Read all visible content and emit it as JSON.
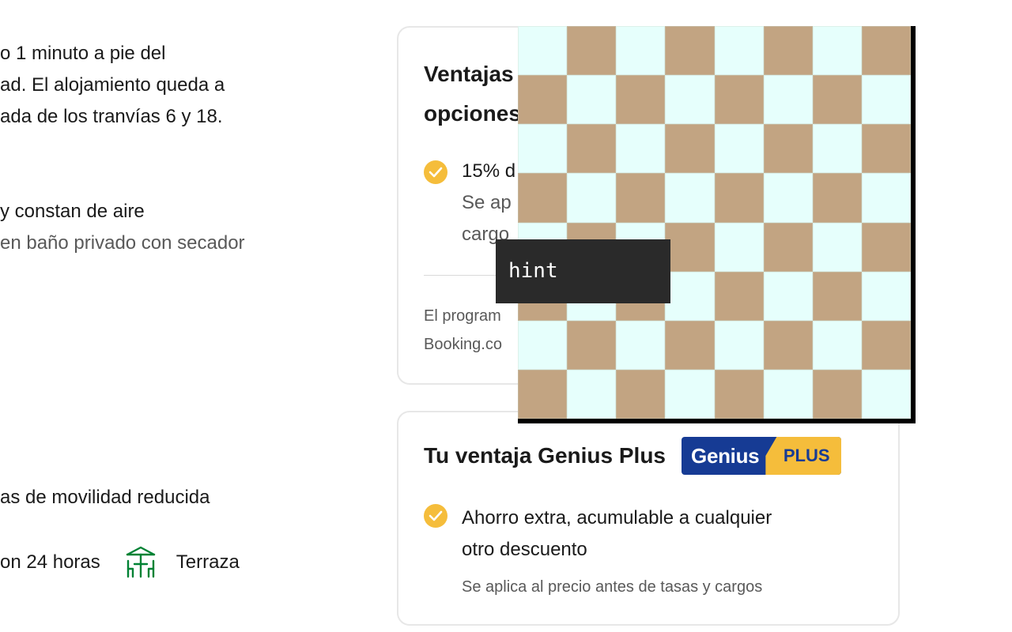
{
  "left": {
    "description_lines": [
      "o 1 minuto a pie del",
      "ad. El alojamiento queda a",
      "ada de los tranvías 6 y 18."
    ],
    "rooms_line1": "y constan de aire",
    "rooms_line2": "en baño privado con secador",
    "mobility": "as de movilidad reducida",
    "facility_1": "on 24 horas",
    "facility_2": "Terraza",
    "facility_2_icon": "terrace-icon"
  },
  "card_top": {
    "title_line1": "Ventajas",
    "title_line2": "opciones",
    "benefit_main": "15% d",
    "benefit_sub_1": "Se ap",
    "benefit_sub_2": "cargo",
    "footer_line1": "El program",
    "footer_line2": "Booking.co"
  },
  "card_bottom": {
    "title": "Tu ventaja Genius Plus",
    "badge_genius": "Genius",
    "badge_plus": "PLUS",
    "benefit_line1": "Ahorro extra, acumulable a cualquier",
    "benefit_line2": "otro descuento",
    "small": "Se aplica al precio antes de tasas y cargos"
  },
  "overlay": {
    "hint": "hint"
  },
  "colors": {
    "check": "#f5bd3b",
    "genius_blue": "#163b94",
    "plus_yellow": "#f5bd3b",
    "icon_green": "#008234",
    "checker_tan": "#c2a482",
    "checker_light": "#e6fffc"
  }
}
